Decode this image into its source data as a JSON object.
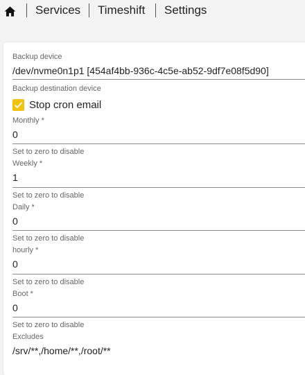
{
  "nav": {
    "items": [
      {
        "label": "Services"
      },
      {
        "label": "Timeshift"
      },
      {
        "label": "Settings"
      }
    ]
  },
  "icons": {
    "home": "home-icon",
    "check": "check-icon"
  },
  "colors": {
    "accent": "#f4c20d"
  },
  "form": {
    "backup_device": {
      "label": "Backup device",
      "value": "/dev/nvme0n1p1 [454af4bb-936c-4c5e-ab52-9df7e08f5d90]",
      "hint": "Backup destination device"
    },
    "stop_cron_email": {
      "label": "Stop cron email",
      "checked": true
    },
    "monthly": {
      "label": "Monthly *",
      "value": "0",
      "hint": "Set to zero to disable"
    },
    "weekly": {
      "label": "Weekly *",
      "value": "1",
      "hint": "Set to zero to disable"
    },
    "daily": {
      "label": "Daily *",
      "value": "0",
      "hint": "Set to zero to disable"
    },
    "hourly": {
      "label": "hourly *",
      "value": "0",
      "hint": "Set to zero to disable"
    },
    "boot": {
      "label": "Boot *",
      "value": "0",
      "hint": "Set to zero to disable"
    },
    "excludes": {
      "label": "Excludes",
      "value": "/srv/**,/home/**,/root/**"
    }
  }
}
